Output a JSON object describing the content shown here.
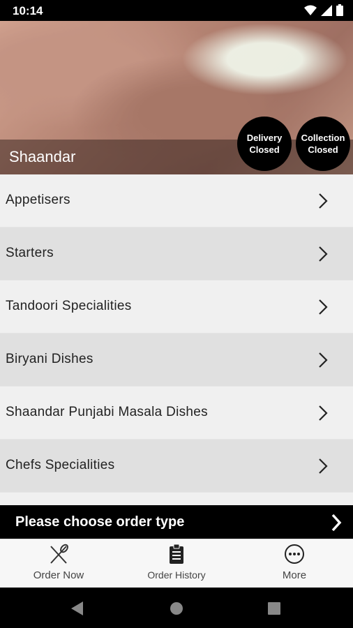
{
  "status": {
    "time": "10:14"
  },
  "restaurant": {
    "name": "Shaandar"
  },
  "badges": {
    "delivery": {
      "line1": "Delivery",
      "line2": "Closed"
    },
    "collection": {
      "line1": "Collection",
      "line2": "Closed"
    }
  },
  "menu": {
    "items": [
      {
        "label": "Appetisers"
      },
      {
        "label": "Starters"
      },
      {
        "label": "Tandoori Specialities"
      },
      {
        "label": "Biryani Dishes"
      },
      {
        "label": "Shaandar Punjabi Masala Dishes"
      },
      {
        "label": "Chefs Specialities"
      }
    ],
    "row_colors": [
      "#f0f0f0",
      "#e0e0e0"
    ]
  },
  "order_bar": {
    "label": "Please choose order type"
  },
  "tabs": [
    {
      "label": "Order Now",
      "icon": "cutlery-icon"
    },
    {
      "label": "Order History",
      "icon": "clipboard-icon"
    },
    {
      "label": "More",
      "icon": "more-icon"
    }
  ]
}
